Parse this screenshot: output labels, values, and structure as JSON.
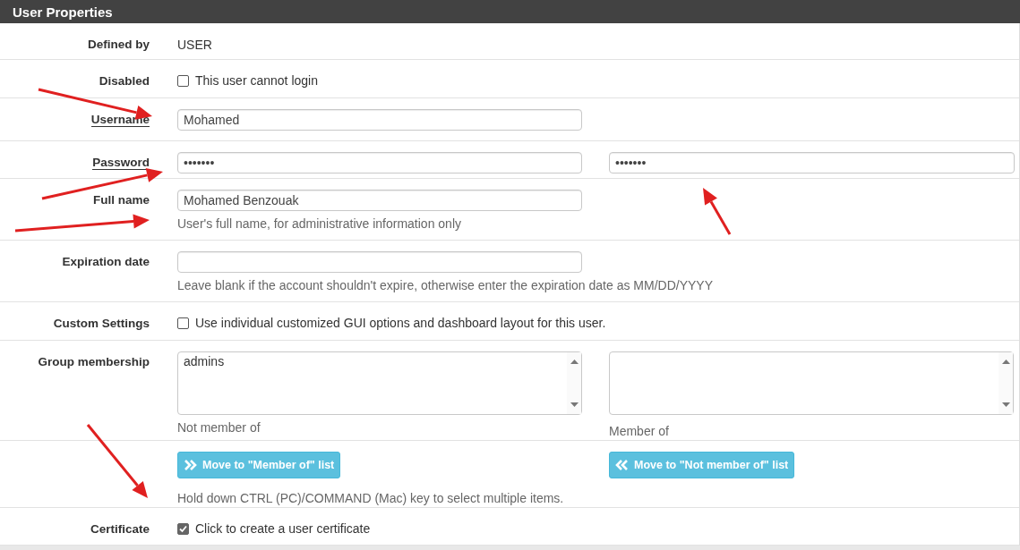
{
  "panel": {
    "title": "User Properties"
  },
  "rows": [
    {
      "kind": "text",
      "label": "Defined by",
      "underlined": false,
      "value": "USER"
    },
    {
      "kind": "checkbox",
      "label": "Disabled",
      "underlined": false,
      "checked": false,
      "text": "This user cannot login"
    },
    {
      "kind": "input",
      "label": "Username",
      "underlined": true,
      "value": "Mohamed"
    },
    {
      "kind": "input_pair",
      "label": "Password",
      "underlined": true,
      "values": [
        "•••••••",
        "•••••••"
      ]
    },
    {
      "kind": "input",
      "label": "Full name",
      "underlined": false,
      "value": "Mohamed Benzouak",
      "help": "User's full name, for administrative information only"
    },
    {
      "kind": "input",
      "label": "Expiration date",
      "underlined": false,
      "help": "Leave blank if the account shouldn't expire, otherwise enter the expiration date as MM/DD/YYYY"
    },
    {
      "kind": "checkbox",
      "label": "Custom Settings",
      "underlined": false,
      "checked": false,
      "text": "Use individual customized GUI options and dashboard layout for this user."
    },
    {
      "kind": "listbox_pair",
      "label": "Group membership",
      "underlined": false,
      "lists": [
        {
          "options": [
            "admins"
          ],
          "caption": "Not member of"
        },
        {
          "caption": "Member of"
        }
      ]
    },
    {
      "kind": "buttons",
      "buttons": [
        {
          "text": "Move to \"Member of\" list",
          "kind": "right"
        },
        {
          "text": "Move to \"Not member of\" list",
          "kind": "left"
        }
      ],
      "help": "Hold down CTRL (PC)/COMMAND (Mac) key to select multiple items."
    },
    {
      "kind": "checkbox",
      "label": "Certificate",
      "underlined": false,
      "checked": true,
      "text": "Click to create a user certificate"
    }
  ]
}
